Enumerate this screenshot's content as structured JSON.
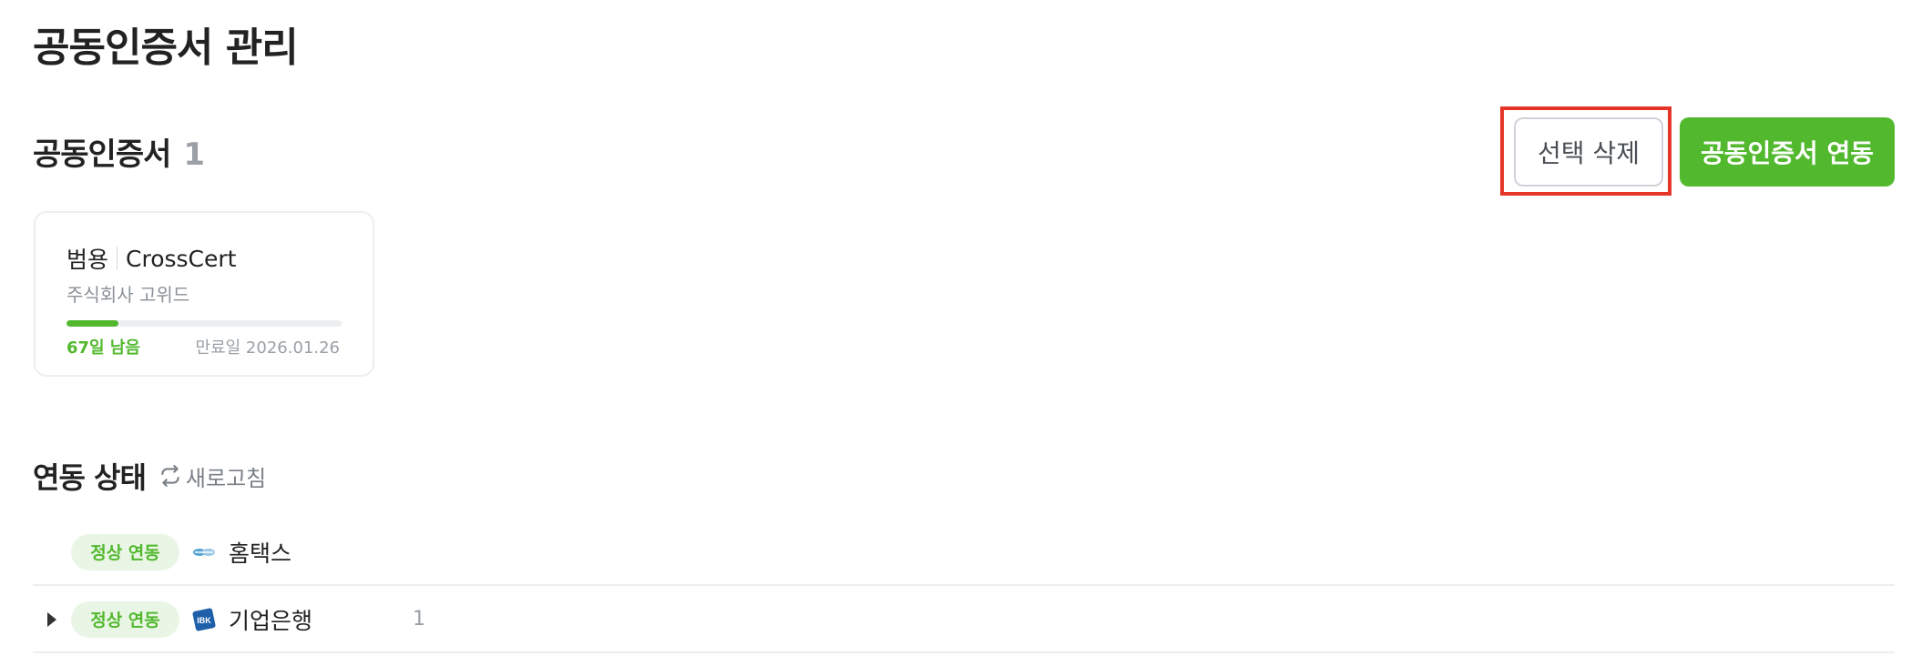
{
  "page": {
    "title": "공동인증서 관리"
  },
  "certificates": {
    "header_label": "공동인증서",
    "count": "1",
    "delete_button_label": "선택 삭제",
    "connect_button_label": "공동인증서 연동",
    "items": [
      {
        "type": "범용",
        "issuer": "CrossCert",
        "owner": "주식회사 고위드",
        "remaining_label": "67일 남음",
        "expiry_label": "만료일 2026.01.26",
        "remaining_fraction": 0.19
      }
    ]
  },
  "status": {
    "title": "연동 상태",
    "refresh_label": "새로고침",
    "rows": [
      {
        "badge": "정상 연동",
        "name": "홈택스",
        "icon": "hometax-logo-icon",
        "expandable": false,
        "count": ""
      },
      {
        "badge": "정상 연동",
        "name": "기업은행",
        "icon": "ibk-logo-icon",
        "expandable": true,
        "count": "1"
      }
    ]
  },
  "colors": {
    "accent_green": "#52b92f",
    "highlight_red": "#e53528",
    "muted_gray": "#9aa0a6",
    "badge_bg": "#eaf6e5"
  }
}
